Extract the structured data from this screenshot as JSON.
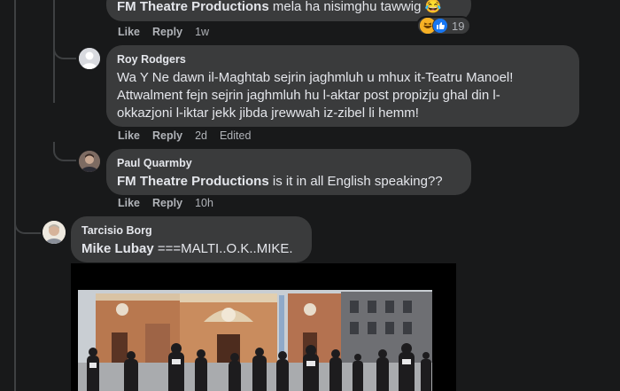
{
  "comments": [
    {
      "mention": "FM Theatre Productions",
      "text": "mela ha nisimghu tawwig",
      "emoji": "😂",
      "actions": {
        "like": "Like",
        "reply": "Reply",
        "time": "1w"
      },
      "reactions": {
        "count": "19",
        "types": [
          "haha",
          "like"
        ]
      }
    },
    {
      "author": "Roy Rodgers",
      "lines": [
        "Wa Y Ne dawn il-Maghtab sejrin jaghmluh u mhux it-Teatru Manoel!",
        "Attwalment fejn sejrin jaghmluh hu l-aktar post propizju ghal din l-",
        "okkazjoni l-iktar jekk jibda jrewwah iz-zibel li hemm!"
      ],
      "actions": {
        "like": "Like",
        "reply": "Reply",
        "time": "2d",
        "edited": "Edited"
      }
    },
    {
      "author": "Paul Quarmby",
      "mention": "FM Theatre Productions",
      "text": "is it in all English speaking??",
      "actions": {
        "like": "Like",
        "reply": "Reply",
        "time": "10h"
      }
    },
    {
      "author": "Tarcisio Borg",
      "mention": "Mike Lubay",
      "text": "===MALTI..O.K..MIKE."
    }
  ],
  "colors": {
    "background": "#18191a",
    "bubble": "#3a3b3c",
    "text": "#e4e6eb",
    "secondary": "#b0b3b8",
    "thread_line": "#3e4042"
  }
}
